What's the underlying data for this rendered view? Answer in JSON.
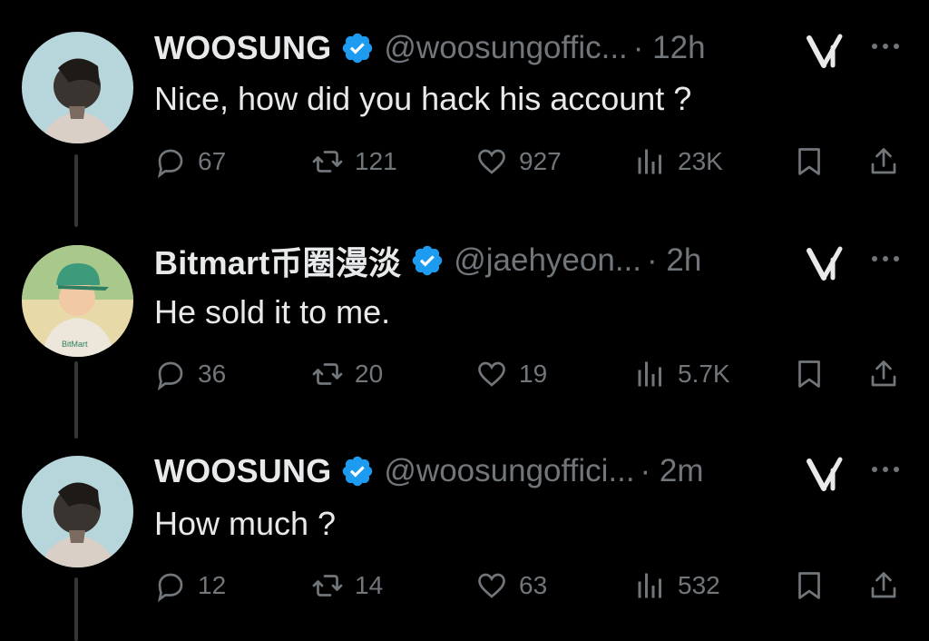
{
  "tweets": [
    {
      "name": "WOOSUNG",
      "handle": "@woosungoffic...",
      "time": "· 12h",
      "text": "Nice, how did you hack his account ?",
      "replies": "67",
      "reposts": "121",
      "likes": "927",
      "views": "23K"
    },
    {
      "name": "Bitmart币圈漫淡",
      "handle": "@jaehyeon...",
      "time": "· 2h",
      "text": "He sold it to me.",
      "replies": "36",
      "reposts": "20",
      "likes": "19",
      "views": "5.7K",
      "avatar_label": "BitMart"
    },
    {
      "name": "WOOSUNG",
      "handle": "@woosungoffici...",
      "time": "· 2m",
      "text": "How much ?",
      "replies": "12",
      "reposts": "14",
      "likes": "63",
      "views": "532"
    }
  ],
  "colors": {
    "background": "#000000",
    "text": "#e7e9ea",
    "muted": "#71767b",
    "verified": "#1d9bf0",
    "thread_line": "#333639"
  },
  "icons": [
    "verified-badge-icon",
    "grok-icon",
    "more-icon",
    "reply-icon",
    "repost-icon",
    "like-icon",
    "views-icon",
    "bookmark-icon",
    "share-icon"
  ]
}
